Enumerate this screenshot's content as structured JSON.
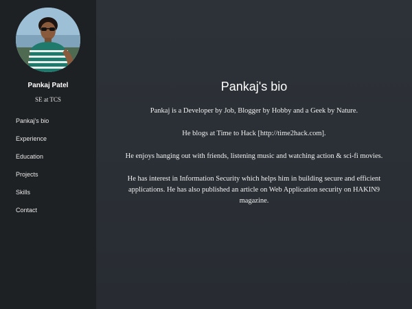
{
  "profile": {
    "name": "Pankaj Patel",
    "role": "SE at TCS"
  },
  "nav": {
    "items": [
      {
        "label": "Pankaj's bio"
      },
      {
        "label": "Experience"
      },
      {
        "label": "Education"
      },
      {
        "label": "Projects"
      },
      {
        "label": "Skills"
      },
      {
        "label": "Contact"
      }
    ]
  },
  "main": {
    "title": "Pankaj's bio",
    "paragraphs": [
      "Pankaj is a Developer by Job, Blogger by Hobby and a Geek by Nature.",
      "He blogs at Time to Hack [http://time2hack.com].",
      "He enjoys hanging out with friends, listening music and watching action & sci-fi movies.",
      "He has interest in Information Security which helps him in building secure and efficient applications. He has also published an article on Web Application security on HAKIN9 magazine."
    ]
  },
  "colors": {
    "sidebar_bg": "#1e2124",
    "main_bg": "#2b3036",
    "text": "#ffffff"
  }
}
